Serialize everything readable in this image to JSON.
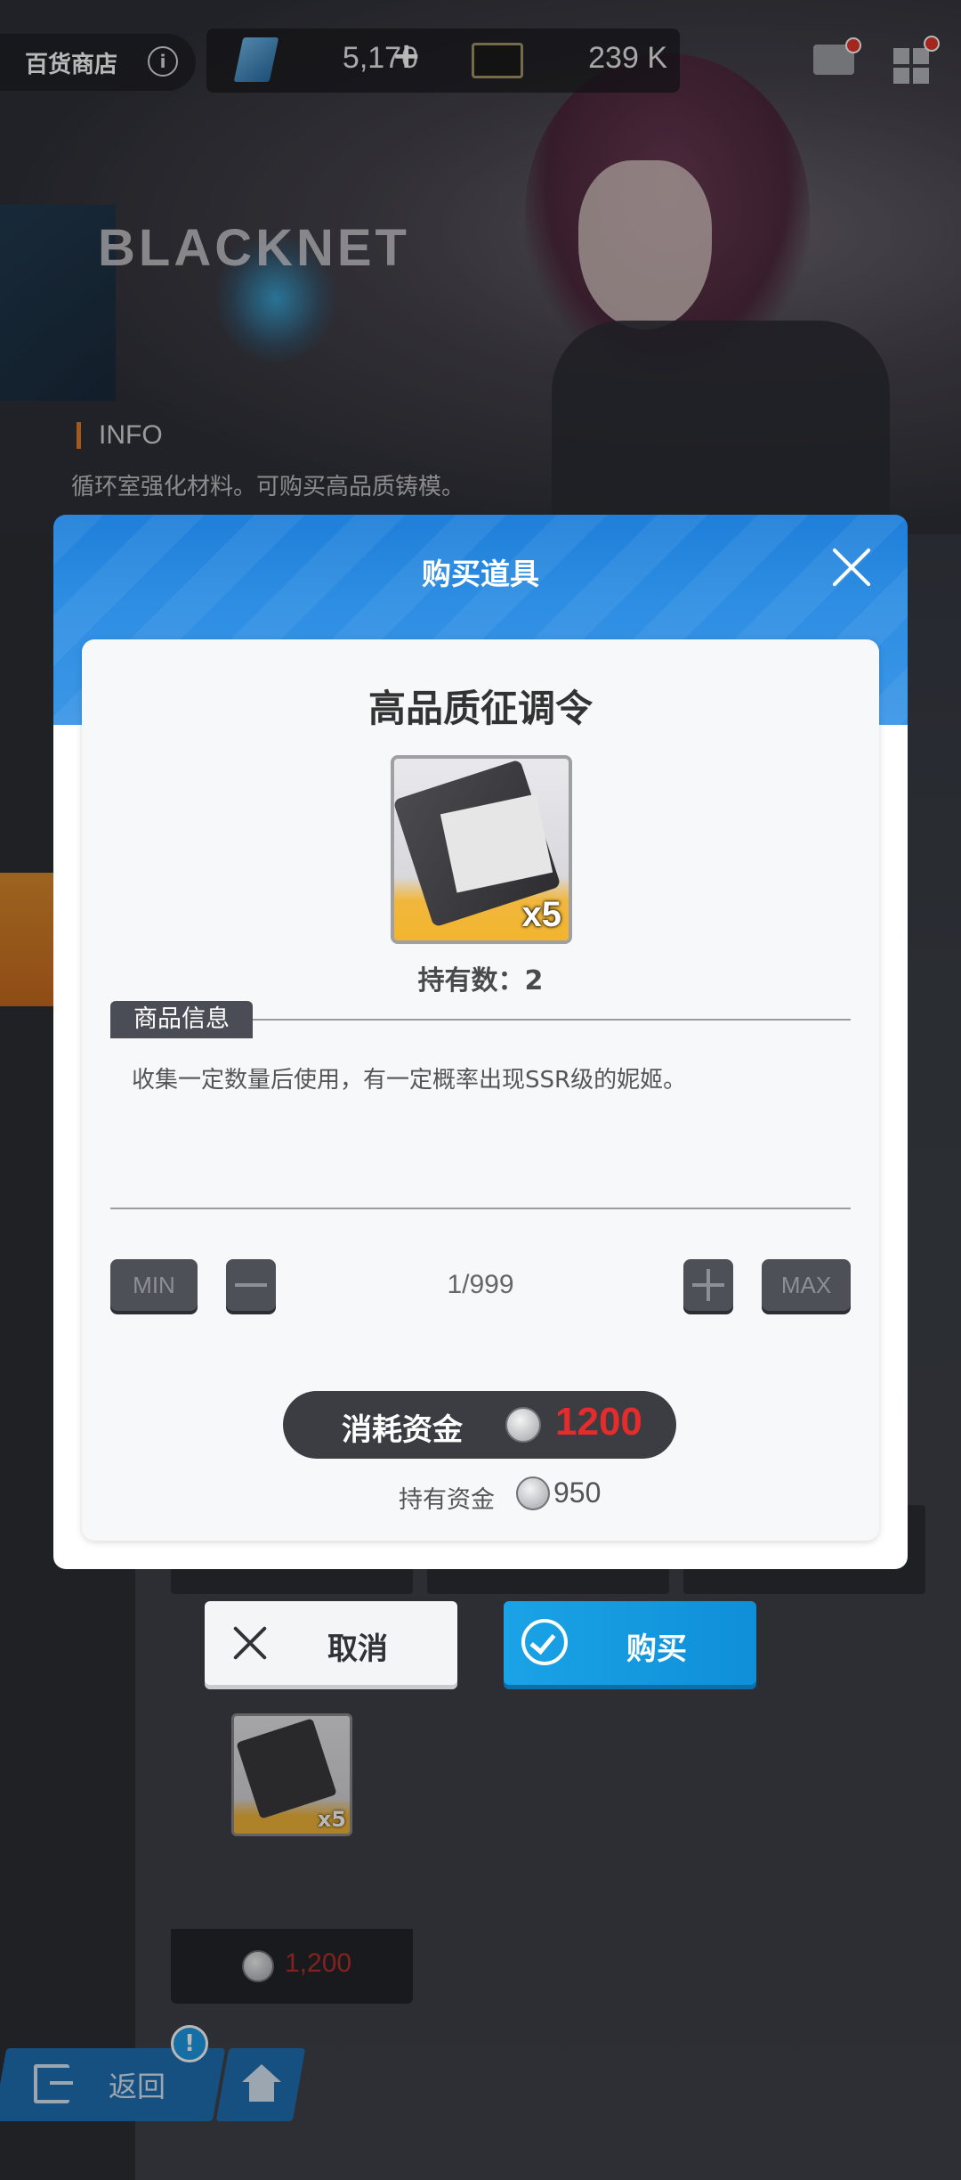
{
  "topbar": {
    "shop_title": "百货商店",
    "info_icon": "info-icon",
    "gem_amount": "5,170",
    "gem_plus": "+",
    "cash_amount": "239 K"
  },
  "banner": {
    "logo_text": "BLACKNET",
    "info_title": "INFO",
    "info_desc": "循环室强化材料。可购买高品质铸模。"
  },
  "dialog": {
    "title": "购买道具",
    "item_name": "高品质征调令",
    "item_badge": "x5",
    "owned_label": "持有数：2",
    "section_tag": "商品信息",
    "description": "收集一定数量后使用，有一定概率出现SSR级的妮姬。",
    "min_label": "MIN",
    "max_label": "MAX",
    "quantity": "1/999",
    "cost_label": "消耗资金",
    "cost_value": "1200",
    "have_label": "持有资金",
    "have_value": "950",
    "cost_color": "#e52b2b"
  },
  "actions": {
    "cancel_label": "取消",
    "buy_label": "购买",
    "buy_color": "#1aa3e6"
  },
  "bottom_card": {
    "badge": "x5",
    "price": "1,200"
  },
  "nav": {
    "return_label": "返回",
    "alert": "!"
  }
}
